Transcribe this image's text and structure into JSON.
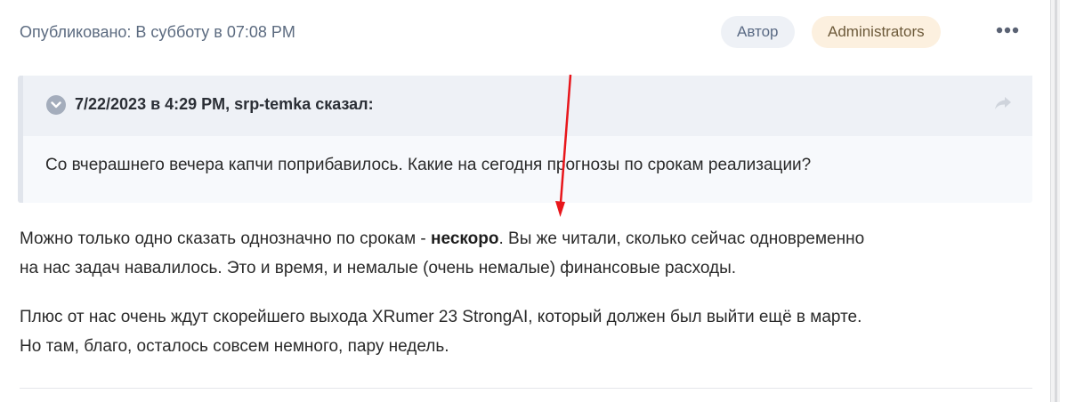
{
  "post": {
    "posted_label": "Опубликовано: В субботу в 07:08 PM",
    "badges": {
      "author": "Автор",
      "group": "Administrators"
    },
    "more_icon": "ellipsis-icon"
  },
  "quote": {
    "title": "7/22/2023 в 4:29 PM, srp-temka сказал:",
    "text": "Со вчерашнего вечера капчи поприбавилось. Какие на сегодня прогнозы по срокам реализации?",
    "collapse_icon": "chevron-down-icon",
    "share_icon": "share-arrow-icon"
  },
  "body": {
    "p1_before": "Можно только одно сказать однозначно по срокам - ",
    "p1_bold": "нескоро",
    "p1_after_line1": ". Вы же читали, сколько сейчас одновременно",
    "p1_line2": "на нас задач навалилось. Это и время, и немалые (очень немалые) финансовые расходы.",
    "p2_line1": "Плюс от нас очень ждут скорейшего выхода XRumer 23 StrongAI, который должен был выйти ещё в марте.",
    "p2_line2": "Но там, благо, осталось совсем немного, пару недель."
  },
  "colors": {
    "annotation_arrow": "#e8161b",
    "badge_author_bg": "#eef1f6",
    "badge_group_bg": "#fcf0df"
  }
}
